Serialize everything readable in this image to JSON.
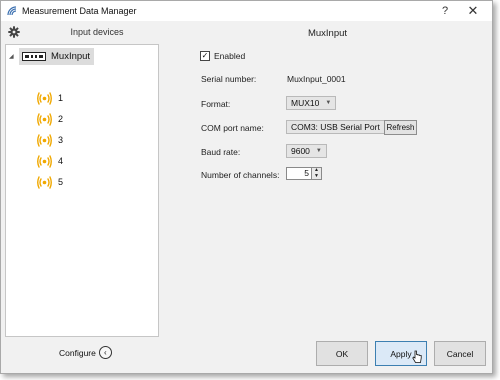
{
  "window": {
    "title": "Measurement Data Manager",
    "help": "?",
    "close": "✕"
  },
  "left": {
    "title": "Input devices",
    "root": {
      "label": "MuxInput"
    },
    "channels": [
      {
        "label": "1"
      },
      {
        "label": "2"
      },
      {
        "label": "3"
      },
      {
        "label": "4"
      },
      {
        "label": "5"
      }
    ],
    "configure_label": "Configure",
    "configure_glyph": "‹"
  },
  "device": {
    "title": "MuxInput",
    "enabled_label": "Enabled",
    "enabled": true,
    "serial_label": "Serial number:",
    "serial_value": "MuxInput_0001",
    "format_label": "Format:",
    "format_value": "MUX10",
    "com_label": "COM port name:",
    "com_value": "COM3: USB Serial Port",
    "refresh_label": "Refresh",
    "baud_label": "Baud rate:",
    "baud_value": "9600",
    "channels_label": "Number of channels:",
    "channels_value": "5"
  },
  "buttons": {
    "ok": "OK",
    "apply": "Apply",
    "cancel": "Cancel"
  },
  "colors": {
    "signal_icon": "#f0a800",
    "apply_border": "#3c7fb1",
    "selection": "#dcdcdc"
  },
  "icons": {
    "app": "signal-wave-icon",
    "settings": "gear-icon",
    "device": "mux-device-icon",
    "channel": "broadcast-icon"
  }
}
